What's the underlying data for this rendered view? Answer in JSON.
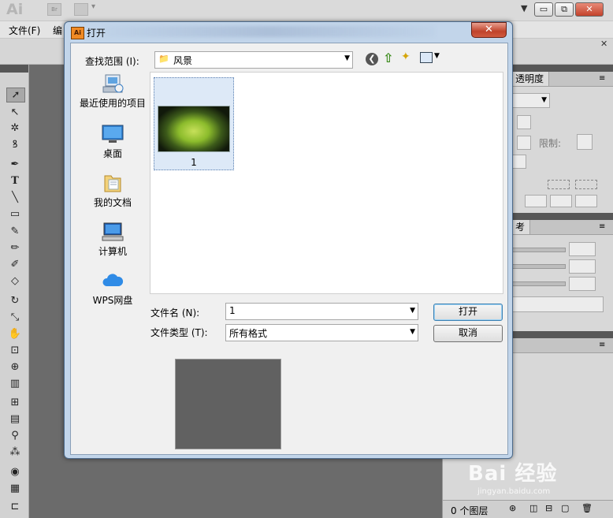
{
  "illustrator": {
    "logo": "Ai",
    "bridge_label": "Br",
    "menu": {
      "file": "文件(F)",
      "edit": "编"
    },
    "window_buttons": {
      "minimize": "▭",
      "restore": "⧉",
      "close": "✕"
    },
    "panels": {
      "transparency_tab": "透明度",
      "limit_label": "限制:",
      "reference_tab": "考",
      "layers_count": "0 个图层"
    }
  },
  "watermark": {
    "text": "Bai 经验",
    "url": "jingyan.baidu.com"
  },
  "dialog": {
    "title": "打开",
    "app_icon": "Ai",
    "close_glyph": "✕",
    "look_in": {
      "label": "查找范围 (I):",
      "value": "风景"
    },
    "places": [
      {
        "label": "最近使用的项目",
        "icon": "recent-items-icon"
      },
      {
        "label": "桌面",
        "icon": "desktop-icon"
      },
      {
        "label": "我的文档",
        "icon": "documents-icon"
      },
      {
        "label": "计算机",
        "icon": "computer-icon"
      },
      {
        "label": "WPS网盘",
        "icon": "cloud-drive-icon"
      }
    ],
    "files": [
      {
        "name": "1"
      }
    ],
    "file_name": {
      "label": "文件名 (N):",
      "value": "1"
    },
    "file_type": {
      "label": "文件类型 (T):",
      "value": "所有格式"
    },
    "buttons": {
      "open": "打开",
      "cancel": "取消"
    }
  },
  "colors": {
    "canvas": "#6b6b6b",
    "dialog_frame": "#c2d5ea",
    "selection": "#dde9f7",
    "close_red": "#c0432b"
  }
}
